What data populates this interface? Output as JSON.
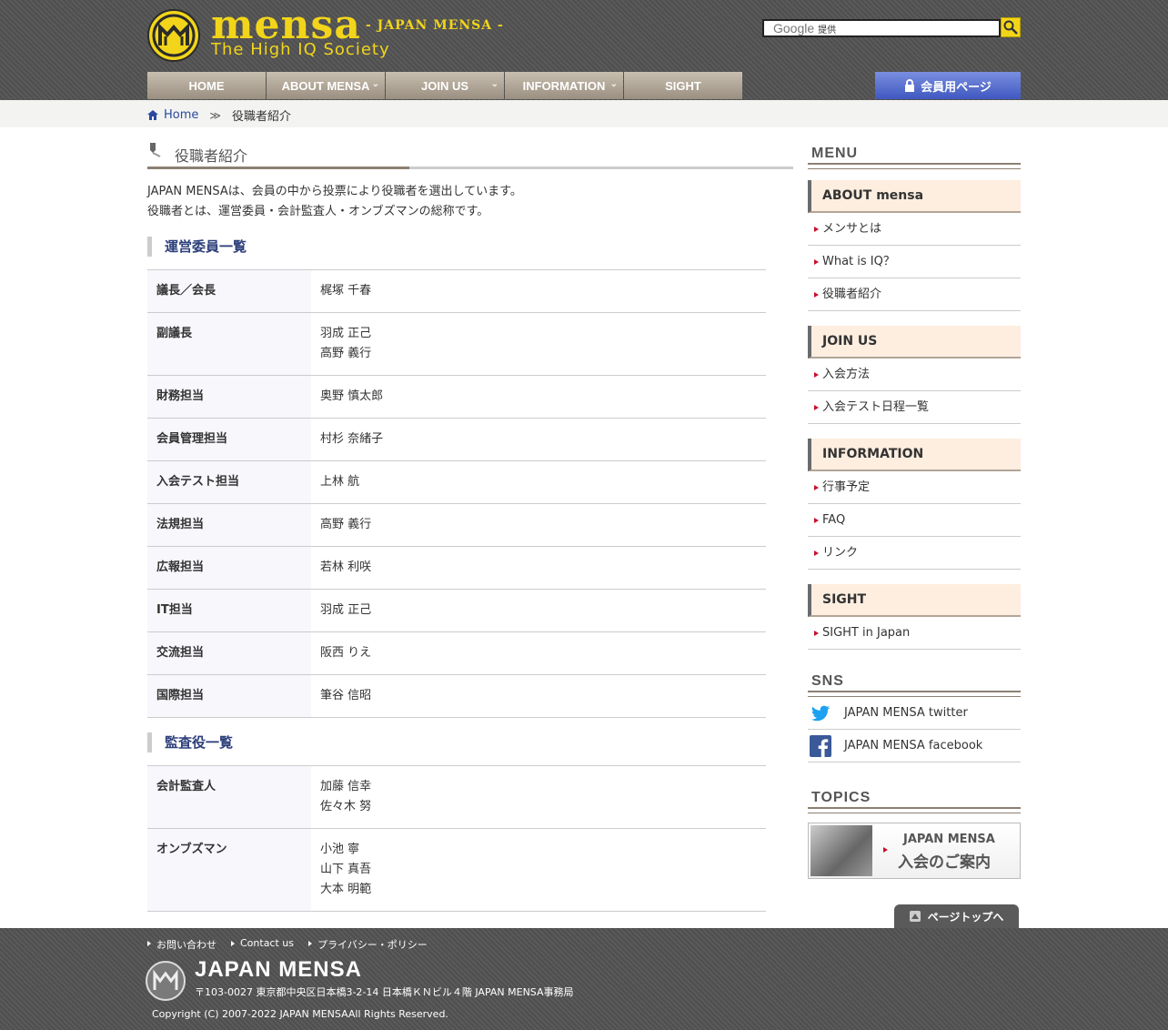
{
  "header": {
    "logo_word": "mensa",
    "logo_sub": "- JAPAN MENSA -",
    "logo_tag": "The High IQ Society",
    "search_brand": "Google",
    "search_note": "提供"
  },
  "nav": [
    {
      "label": "HOME"
    },
    {
      "label": "ABOUT MENSA"
    },
    {
      "label": "JOIN US"
    },
    {
      "label": "INFORMATION"
    },
    {
      "label": "SIGHT"
    }
  ],
  "member_button": "会員用ページ",
  "breadcrumb": {
    "home": "Home",
    "sep": "≫",
    "current": "役職者紹介"
  },
  "main": {
    "title": "役職者紹介",
    "intro_line1": "JAPAN MENSAは、会員の中から投票により役職者を選出しています。",
    "intro_line2": "役職者とは、運営委員・会計監査人・オンブズマンの総称です。",
    "section1": "運営委員一覧",
    "committee": [
      {
        "role": "議長／会長",
        "names": [
          "梶塚 千春"
        ]
      },
      {
        "role": "副議長",
        "names": [
          "羽成 正己",
          "高野 義行"
        ]
      },
      {
        "role": "財務担当",
        "names": [
          "奥野 慎太郎"
        ]
      },
      {
        "role": "会員管理担当",
        "names": [
          "村杉 奈緒子"
        ]
      },
      {
        "role": "入会テスト担当",
        "names": [
          "上林 航"
        ]
      },
      {
        "role": "法規担当",
        "names": [
          "高野 義行"
        ]
      },
      {
        "role": "広報担当",
        "names": [
          "若林 利咲"
        ]
      },
      {
        "role": "IT担当",
        "names": [
          "羽成 正己"
        ]
      },
      {
        "role": "交流担当",
        "names": [
          "阪西 りえ"
        ]
      },
      {
        "role": "国際担当",
        "names": [
          "筆谷 信昭"
        ]
      }
    ],
    "section2": "監査役一覧",
    "auditors": [
      {
        "role": "会計監査人",
        "names": [
          "加藤 信幸",
          "佐々木 努"
        ]
      },
      {
        "role": "オンブズマン",
        "names": [
          "小池 寧",
          "山下 真吾",
          "大本 明範"
        ]
      }
    ]
  },
  "sidebar": {
    "menu_heading": "MENU",
    "groups": [
      {
        "title": "ABOUT mensa",
        "items": [
          "メンサとは",
          "What is IQ？",
          "役職者紹介"
        ]
      },
      {
        "title": "JOIN US",
        "items": [
          "入会方法",
          "入会テスト日程一覧"
        ]
      },
      {
        "title": "INFORMATION",
        "items": [
          "行事予定",
          "FAQ",
          "リンク"
        ]
      },
      {
        "title": "SIGHT",
        "items": [
          "SIGHT in Japan"
        ]
      }
    ],
    "sns_heading": "SNS",
    "sns": [
      {
        "label": "JAPAN MENSA twitter",
        "icon": "twitter-icon",
        "color": "#1da1f2"
      },
      {
        "label": "JAPAN MENSA facebook",
        "icon": "facebook-icon",
        "color": "#3b5998"
      }
    ],
    "topics_heading": "TOPICS",
    "topic_line1": "JAPAN MENSA",
    "topic_line2": "入会のご案内"
  },
  "pagetop": "ページトップへ",
  "footer": {
    "links": [
      "お問い合わせ",
      "Contact us",
      "プライバシー・ポリシー"
    ],
    "name": "JAPAN MENSA",
    "address": "〒103-0027 東京都中央区日本橋3-2-14 日本橋ＫＮビル４階 JAPAN MENSA事務局",
    "copyright": "Copyright (C) 2007-2022 JAPAN MENSAAll Rights Reserved."
  },
  "colors": {
    "accent": "#f2d51a",
    "link": "#2a4aa0",
    "heading": "#2c3f7a",
    "bullet": "#c8102e"
  }
}
